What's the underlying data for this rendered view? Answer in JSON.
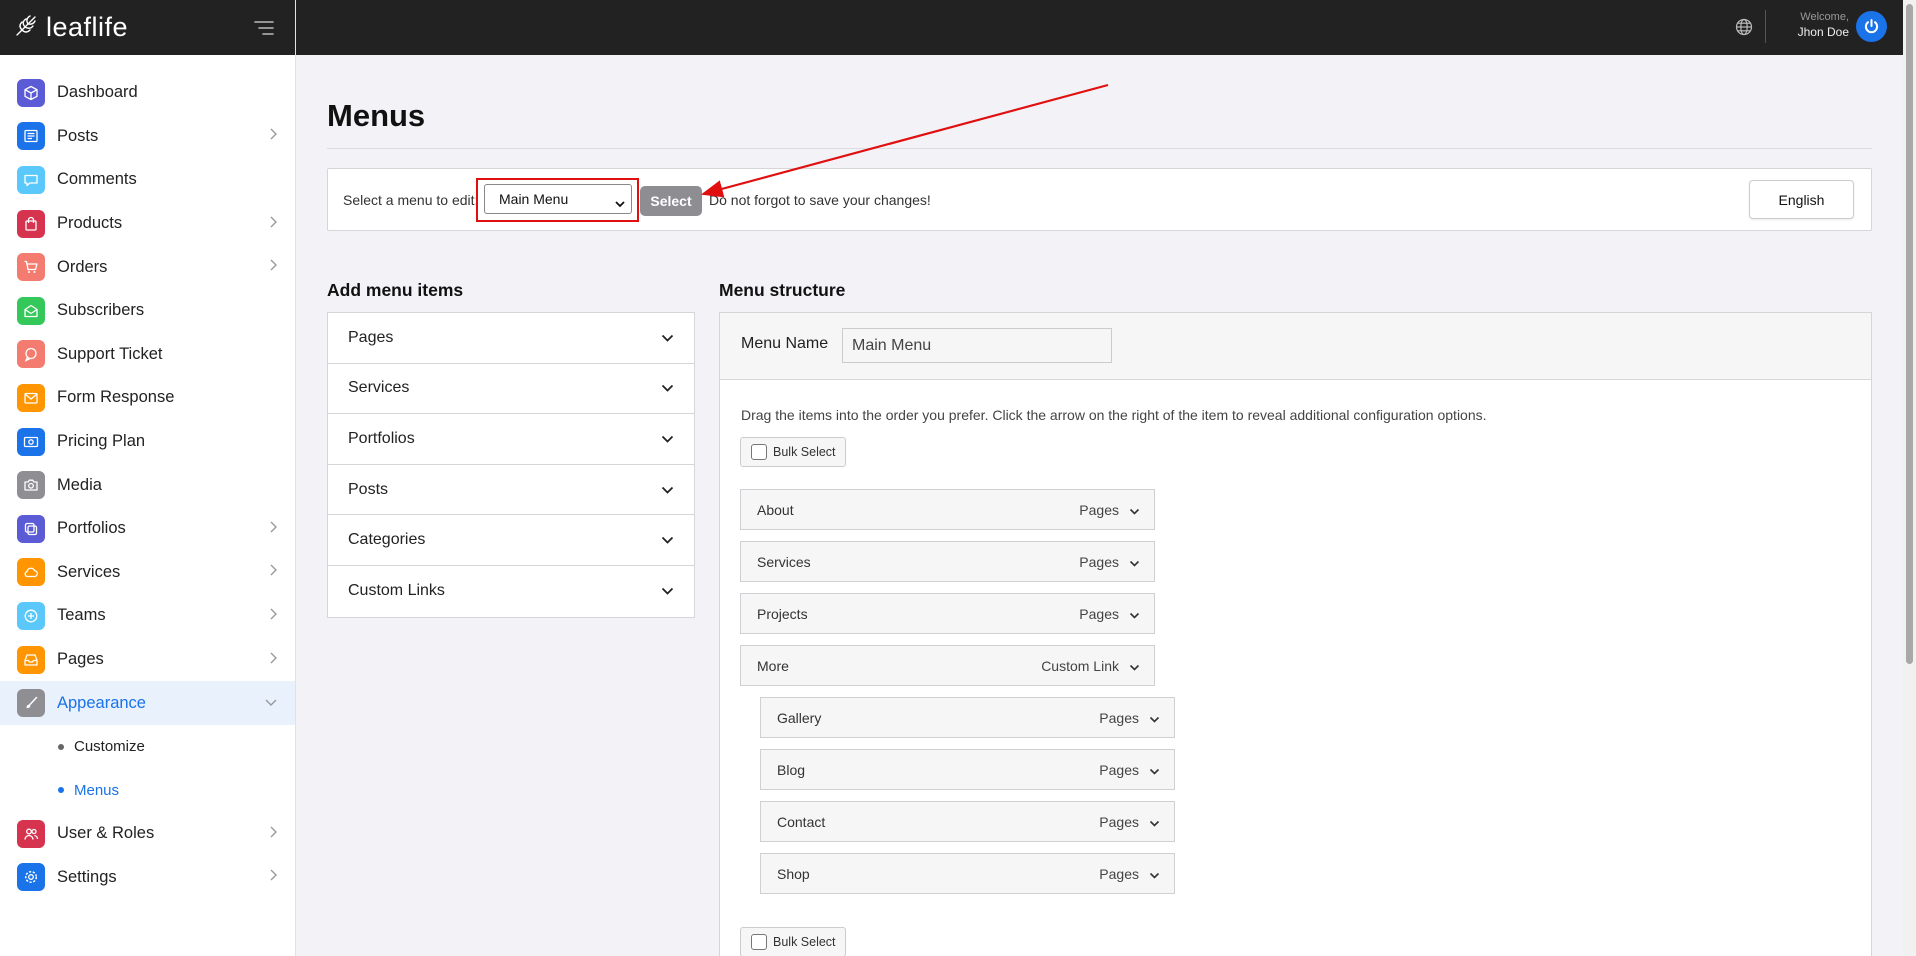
{
  "brand": {
    "name": "leaflife"
  },
  "user": {
    "welcome": "Welcome,",
    "name": "Jhon Doe"
  },
  "sidebar": {
    "items": [
      {
        "label": "Dashboard",
        "icon": "cube-icon",
        "color": "#5b5bd6",
        "has_children": false
      },
      {
        "label": "Posts",
        "icon": "newspaper-icon",
        "color": "#1a73e8",
        "has_children": true
      },
      {
        "label": "Comments",
        "icon": "chat-icon",
        "color": "#5ac8fa",
        "has_children": false
      },
      {
        "label": "Products",
        "icon": "bag-icon",
        "color": "#d6334e",
        "has_children": true
      },
      {
        "label": "Orders",
        "icon": "cart-icon",
        "color": "#f47b6f",
        "has_children": true
      },
      {
        "label": "Subscribers",
        "icon": "mail-open-icon",
        "color": "#34c759",
        "has_children": false
      },
      {
        "label": "Support Ticket",
        "icon": "support-icon",
        "color": "#f47b6f",
        "has_children": false
      },
      {
        "label": "Form Response",
        "icon": "envelope-icon",
        "color": "#ff9500",
        "has_children": false
      },
      {
        "label": "Pricing Plan",
        "icon": "money-icon",
        "color": "#1a73e8",
        "has_children": false
      },
      {
        "label": "Media",
        "icon": "camera-icon",
        "color": "#8e8e93",
        "has_children": false
      },
      {
        "label": "Portfolios",
        "icon": "copy-icon",
        "color": "#5b5bd6",
        "has_children": true
      },
      {
        "label": "Services",
        "icon": "cloud-icon",
        "color": "#ff9500",
        "has_children": true
      },
      {
        "label": "Teams",
        "icon": "plus-circle-icon",
        "color": "#5ac8fa",
        "has_children": true
      },
      {
        "label": "Pages",
        "icon": "inbox-icon",
        "color": "#ff9500",
        "has_children": true
      },
      {
        "label": "Appearance",
        "icon": "brush-icon",
        "color": "#8e8e93",
        "has_children": true,
        "expanded": true,
        "active": true
      },
      {
        "label": "User & Roles",
        "icon": "users-icon",
        "color": "#d6334e",
        "has_children": true
      },
      {
        "label": "Settings",
        "icon": "cog-icon",
        "color": "#1a73e8",
        "has_children": true
      }
    ],
    "appearance_sub": [
      {
        "label": "Customize",
        "current": false
      },
      {
        "label": "Menus",
        "current": true
      }
    ]
  },
  "page": {
    "title": "Menus",
    "selector": {
      "label": "Select a menu to edit:",
      "selected": "Main Menu",
      "button": "Select",
      "note": "Do not forgot to save your changes!",
      "language": "English"
    },
    "add_items": {
      "heading": "Add menu items",
      "panels": [
        "Pages",
        "Services",
        "Portfolios",
        "Posts",
        "Categories",
        "Custom Links"
      ]
    },
    "structure": {
      "heading": "Menu structure",
      "name_label": "Menu Name",
      "name_value": "Main Menu",
      "hint": "Drag the items into the order you prefer. Click the arrow on the right of the item to reveal additional configuration options.",
      "bulk_label": "Bulk Select",
      "items": [
        {
          "name": "About",
          "type": "Pages",
          "depth": 0
        },
        {
          "name": "Services",
          "type": "Pages",
          "depth": 0
        },
        {
          "name": "Projects",
          "type": "Pages",
          "depth": 0
        },
        {
          "name": "More",
          "type": "Custom Link",
          "depth": 0
        },
        {
          "name": "Gallery",
          "type": "Pages",
          "depth": 1
        },
        {
          "name": "Blog",
          "type": "Pages",
          "depth": 1
        },
        {
          "name": "Contact",
          "type": "Pages",
          "depth": 1
        },
        {
          "name": "Shop",
          "type": "Pages",
          "depth": 1
        }
      ]
    }
  },
  "colors": {
    "accent": "#1a73e8",
    "topbar": "#222222",
    "highlight": "#e01010"
  }
}
